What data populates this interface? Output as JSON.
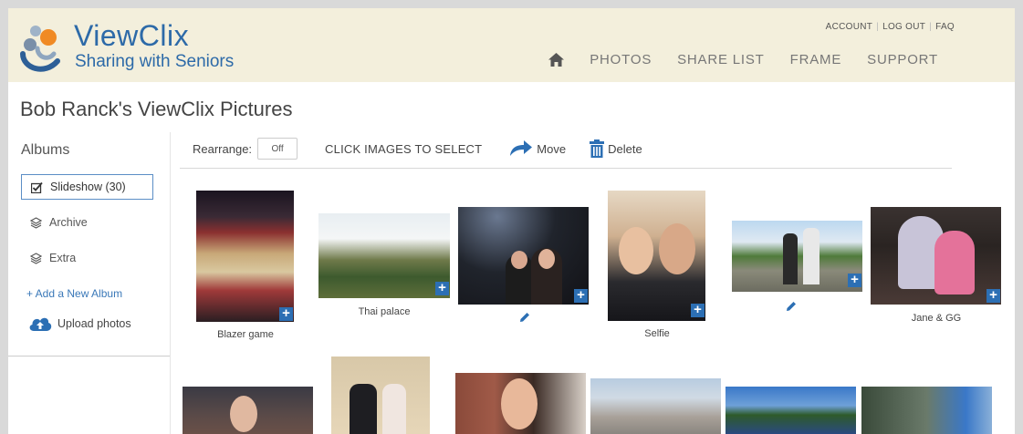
{
  "header": {
    "logo_title": "ViewClix",
    "logo_sub": "Sharing with Seniors",
    "top_links": [
      "ACCOUNT",
      "LOG OUT",
      "FAQ"
    ],
    "nav": [
      "PHOTOS",
      "SHARE LIST",
      "FRAME",
      "SUPPORT"
    ],
    "nav_home_icon": "home-icon"
  },
  "page_title": "Bob Ranck's ViewClix Pictures",
  "sidebar": {
    "heading": "Albums",
    "albums": [
      {
        "label": "Slideshow (30)",
        "icon": "checkbox-icon",
        "active": true
      },
      {
        "label": "Archive",
        "icon": "layers-icon",
        "active": false
      },
      {
        "label": "Extra",
        "icon": "layers-icon",
        "active": false
      }
    ],
    "add_album": "+ Add a New Album",
    "upload": "Upload photos"
  },
  "toolbar": {
    "rearrange_label": "Rearrange:",
    "toggle_value": "Off",
    "hint": "CLICK IMAGES TO SELECT",
    "move_label": "Move",
    "delete_label": "Delete"
  },
  "photos": [
    {
      "caption": "Blazer game"
    },
    {
      "caption": "Thai palace"
    },
    {
      "caption": ""
    },
    {
      "caption": "Selfie"
    },
    {
      "caption": ""
    },
    {
      "caption": "Jane & GG"
    }
  ],
  "colors": {
    "accent": "#2c6fb4",
    "header_bg": "#f3efdc",
    "logo": "#2d6aa8"
  }
}
